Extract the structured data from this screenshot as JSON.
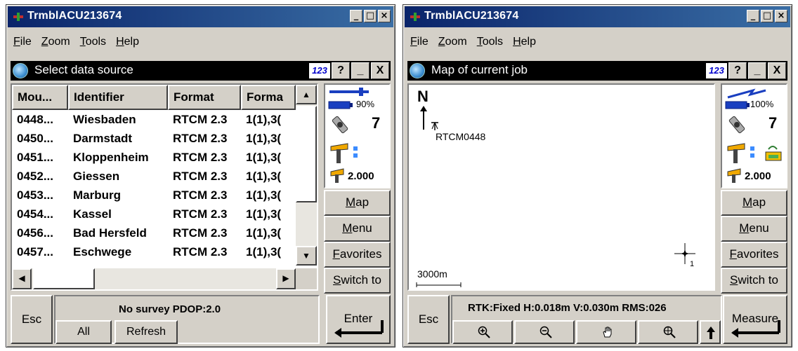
{
  "window1": {
    "title": "TrmblACU213674",
    "menu": [
      "File",
      "Zoom",
      "Tools",
      "Help"
    ],
    "app_title": "Select data source",
    "app_buttons": {
      "input_mode": "123",
      "help": "?",
      "minimize": "_",
      "close": "X"
    },
    "table": {
      "headers": [
        "Mou...",
        "Identifier",
        "Format",
        "Forma"
      ],
      "rows": [
        [
          "0448...",
          "Wiesbaden",
          "RTCM 2.3",
          "1(1),3("
        ],
        [
          "0450...",
          "Darmstadt",
          "RTCM 2.3",
          "1(1),3("
        ],
        [
          "0451...",
          "Kloppenheim",
          "RTCM 2.3",
          "1(1),3("
        ],
        [
          "0452...",
          "Giessen",
          "RTCM 2.3",
          "1(1),3("
        ],
        [
          "0453...",
          "Marburg",
          "RTCM 2.3",
          "1(1),3("
        ],
        [
          "0454...",
          "Kassel",
          "RTCM 2.3",
          "1(1),3("
        ],
        [
          "0456...",
          "Bad Hersfeld",
          "RTCM 2.3",
          "1(1),3("
        ],
        [
          "0457...",
          "Eschwege",
          "RTCM 2.3",
          "1(1),3("
        ]
      ]
    },
    "status": {
      "battery": "90%",
      "satellites": "7",
      "antenna_height": "2.000"
    },
    "side_buttons": [
      "Map",
      "Menu",
      "Favorites",
      "Switch to"
    ],
    "esc_label": "Esc",
    "status_message": "No survey  PDOP:2.0",
    "all_label": "All",
    "refresh_label": "Refresh",
    "enter_label": "Enter"
  },
  "window2": {
    "title": "TrmblACU213674",
    "menu": [
      "File",
      "Zoom",
      "Tools",
      "Help"
    ],
    "app_title": "Map of current job",
    "app_buttons": {
      "input_mode": "123",
      "help": "?",
      "minimize": "_",
      "close": "X"
    },
    "map": {
      "north_label": "N",
      "point_label": "RTCM0448",
      "scale_label": "3000m",
      "cursor_sub": "1"
    },
    "status": {
      "battery": "100%",
      "satellites": "7",
      "antenna_height": "2.000"
    },
    "side_buttons": [
      "Map",
      "Menu",
      "Favorites",
      "Switch to"
    ],
    "esc_label": "Esc",
    "status_message": "RTK:Fixed H:0.018m V:0.030m RMS:026",
    "tools": [
      "zoom-in-icon",
      "zoom-out-icon",
      "pan-hand-icon",
      "zoom-extents-icon"
    ],
    "measure_label": "Measure"
  }
}
